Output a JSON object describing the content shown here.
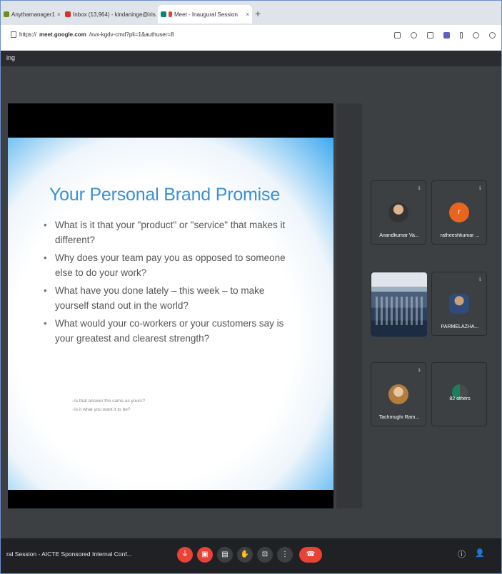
{
  "browser": {
    "tabs": [
      {
        "title": "Anythamanager1",
        "icon": "doc-icon",
        "active": false
      },
      {
        "title": "Inbox (13,964) - kindaninge@iris.",
        "icon": "gmail-icon",
        "active": false
      },
      {
        "title": "Meet - Inaugural Session",
        "icon": "meet-icon",
        "active": true
      }
    ],
    "new_tab_label": "+",
    "url_prefix": "https://",
    "url_host": "meet.google.com",
    "url_path": "/xvx-kgdv-cmd?pli=1&authuser=8"
  },
  "meet": {
    "header_title": "ing",
    "meeting_name": "ral Session - AICTE Sponsored Internal Conf...",
    "slide": {
      "title": "Your Personal Brand Promise",
      "bullets": [
        "What is it that your \"product\" or \"service\" that makes it different?",
        "Why does your team pay you as opposed to someone else to do your work?",
        "What have you done lately – this week – to make yourself stand out in the world?",
        "What would your co-workers or your customers say is your greatest and clearest strength?"
      ],
      "sub_bullets": [
        "Is that answer the same as yours?",
        "Is it what you want it to be?"
      ]
    },
    "participants": [
      {
        "name": "Anandkumar Va...",
        "avatar": "photo"
      },
      {
        "name": "ratheeshkumar ...",
        "avatar": "letter",
        "letter": "r"
      },
      {
        "name": "",
        "avatar": "video"
      },
      {
        "name": "PARMELAZHA...",
        "avatar": "photo"
      },
      {
        "name": "Tachmughi Ram...",
        "avatar": "photo"
      },
      {
        "name": "82 others",
        "avatar": "group"
      }
    ],
    "controls": {
      "mic": "mic-off-icon",
      "camera": "camera-off-icon",
      "captions": "captions-icon",
      "hand": "raise-hand-icon",
      "present": "present-icon",
      "more": "more-vert-icon",
      "end": "end-call-icon"
    },
    "accent_red": "#ea4335",
    "avatar_orange": "#e8651f"
  }
}
